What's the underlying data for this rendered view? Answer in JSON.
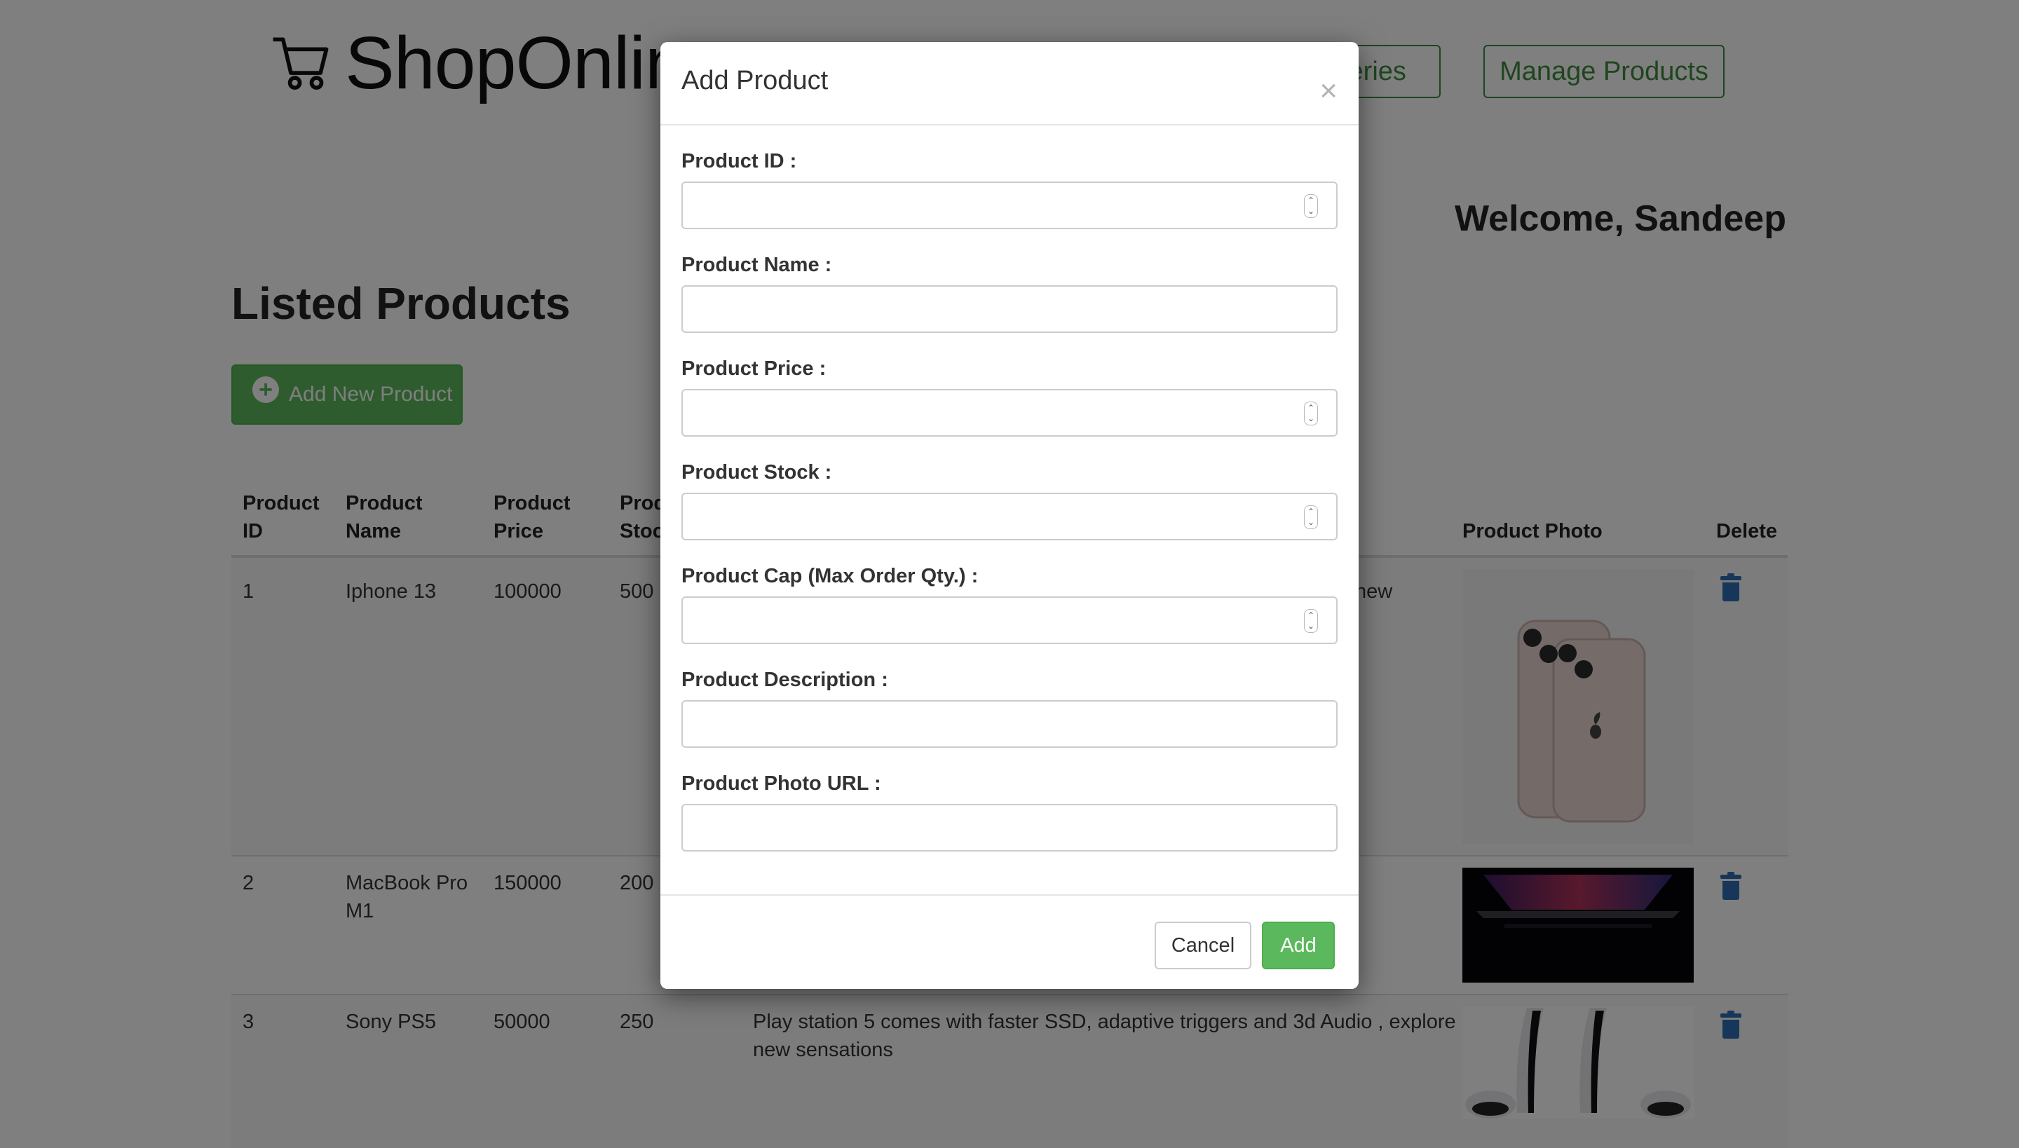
{
  "header": {
    "brand": "ShopOnline",
    "nav": {
      "deliveries": "Deliveries",
      "manage_products": "Manage Products"
    },
    "welcome": "Welcome, Sandeep"
  },
  "main": {
    "title": "Listed Products",
    "add_new_button": "Add New Product",
    "table": {
      "columns": {
        "id_1": "Product",
        "id_2": "ID",
        "name_1": "Product",
        "name_2": "Name",
        "price_1": "Product",
        "price_2": "Price",
        "stock_1": "Product",
        "stock_2": "Stock",
        "photo": "Product Photo",
        "delete": "Delete"
      },
      "rows": [
        {
          "id": "1",
          "name_1": "Iphone 13",
          "name_2": "",
          "price": "100000",
          "stock": "500",
          "desc_1": "new",
          "desc_2": ""
        },
        {
          "id": "2",
          "name_1": "MacBook Pro",
          "name_2": "M1",
          "price": "150000",
          "stock": "200",
          "desc_1": "",
          "desc_2": ""
        },
        {
          "id": "3",
          "name_1": "Sony PS5",
          "name_2": "",
          "price": "50000",
          "stock": "250",
          "desc_1": "Play station 5 comes with faster SSD, adaptive triggers and 3d Audio , explore",
          "desc_2": "new sensations"
        }
      ]
    }
  },
  "modal": {
    "title": "Add Product",
    "close": "×",
    "fields": {
      "product_id": {
        "label": "Product ID :",
        "value": ""
      },
      "product_name": {
        "label": "Product Name :",
        "value": ""
      },
      "product_price": {
        "label": "Product Price :",
        "value": ""
      },
      "product_stock": {
        "label": "Product Stock :",
        "value": ""
      },
      "product_cap": {
        "label": "Product Cap (Max Order Qty.) :",
        "value": ""
      },
      "product_description": {
        "label": "Product Description :",
        "value": ""
      },
      "product_photo_url": {
        "label": "Product Photo URL :",
        "value": ""
      }
    },
    "cancel": "Cancel",
    "add": "Add"
  },
  "colors": {
    "accent_green": "#5cb85c",
    "nav_green": "#3f8a3f",
    "delete_blue": "#2f6fb5",
    "overlay": "rgba(0,0,0,0.5)"
  }
}
